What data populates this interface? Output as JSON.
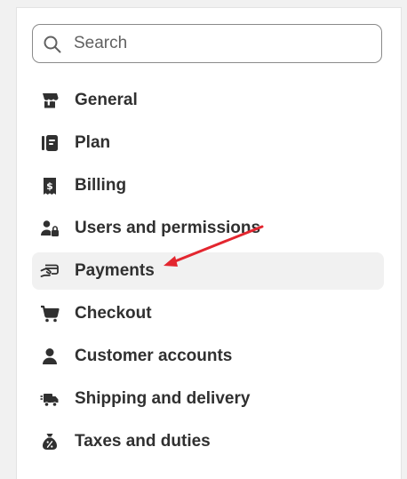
{
  "search": {
    "placeholder": "Search",
    "icon": "search-icon"
  },
  "nav": {
    "items": [
      {
        "label": "General",
        "icon": "store-icon"
      },
      {
        "label": "Plan",
        "icon": "plan-icon"
      },
      {
        "label": "Billing",
        "icon": "billing-receipt-icon"
      },
      {
        "label": "Users and permissions",
        "icon": "users-lock-icon"
      },
      {
        "label": "Payments",
        "icon": "payments-hand-card-icon",
        "active": true
      },
      {
        "label": "Checkout",
        "icon": "cart-icon"
      },
      {
        "label": "Customer accounts",
        "icon": "person-icon"
      },
      {
        "label": "Shipping and delivery",
        "icon": "truck-icon"
      },
      {
        "label": "Taxes and duties",
        "icon": "tax-bag-icon"
      }
    ]
  },
  "colors": {
    "text": "#303030",
    "active_bg": "#f1f1f1",
    "annotation_arrow": "#e3262f"
  }
}
